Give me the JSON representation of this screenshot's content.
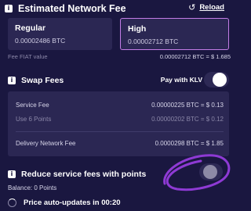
{
  "network_fee": {
    "title": "Estimated Network Fee",
    "reload_label": "Reload",
    "options": [
      {
        "name": "Regular",
        "value": "0.00002486 BTC"
      },
      {
        "name": "High",
        "value": "0.00002712 BTC",
        "selected": true
      }
    ],
    "fiat_label": "Fee FIAT value",
    "fiat_value": "0.00002712 BTC = $ 1.685"
  },
  "swap_fees": {
    "title": "Swap Fees",
    "pay_klv_label": "Pay with KLV",
    "pay_klv_on": true,
    "rows": [
      {
        "label": "Service Fee",
        "value": "0.00000225 BTC = $ 0.13"
      },
      {
        "label": "Use 6 Points",
        "value": "0.00000202 BTC = $ 0.12"
      },
      {
        "label": "Delivery Network Fee",
        "value": "0.0000298 BTC = $ 1.85"
      }
    ]
  },
  "reduce": {
    "title": "Reduce service fees with points",
    "enabled": false,
    "balance": "Balance: 0 Points"
  },
  "auto_update": "Price auto-updates in 00:20",
  "colors": {
    "background": "#1a1740",
    "panel": "#2b2753",
    "accent_border": "#c37ce6",
    "annotation": "#8e3ad4"
  }
}
